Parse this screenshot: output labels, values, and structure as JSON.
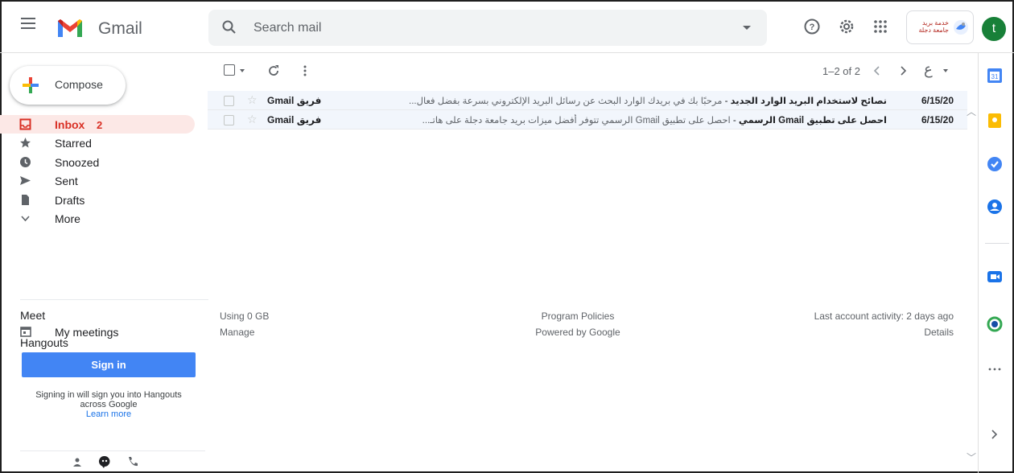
{
  "app": {
    "name": "Gmail"
  },
  "search": {
    "placeholder": "Search mail"
  },
  "org_badge": {
    "text": "خدمة بريد جامعة دجلة"
  },
  "account": {
    "initial": "t",
    "color": "#188038"
  },
  "compose": {
    "label": "Compose"
  },
  "nav": [
    {
      "label": "Inbox",
      "count": "2",
      "icon": "inbox-icon",
      "active": true
    },
    {
      "label": "Starred",
      "icon": "star-icon"
    },
    {
      "label": "Snoozed",
      "icon": "clock-icon"
    },
    {
      "label": "Sent",
      "icon": "send-icon"
    },
    {
      "label": "Drafts",
      "icon": "draft-icon"
    },
    {
      "label": "More",
      "icon": "chevron-down-icon"
    }
  ],
  "meet": {
    "title": "Meet",
    "my_meetings": "My meetings"
  },
  "hangouts": {
    "title": "Hangouts",
    "sign_in": "Sign in",
    "note": "Signing in will sign you into Hangouts across Google",
    "learn_more": "Learn more"
  },
  "toolbar": {
    "pager": "1–2 of 2",
    "lang": "ع"
  },
  "emails": [
    {
      "sender": "فريق Gmail",
      "subject": "نصائح لاستخدام البريد الوارد الجديد",
      "snippet": "مرحبًا بك في بريدك الوارد البحث عن رسائل البريد الإلكتروني بسرعة بفضل فعال...",
      "date": "6/15/20"
    },
    {
      "sender": "فريق Gmail",
      "subject": "احصل على تطبيق Gmail الرسمي",
      "snippet": "احصل على تطبيق Gmail الرسمي تتوفر أفضل ميزات بريد جامعة دجلة على هاتـ...",
      "date": "6/15/20"
    }
  ],
  "footer": {
    "storage": "Using 0 GB",
    "manage": "Manage",
    "policies": "Program Policies",
    "powered": "Powered by Google",
    "activity": "Last account activity: 2 days ago",
    "details": "Details"
  },
  "colors": {
    "accent_red": "#d93025",
    "blue": "#4285f4",
    "active_bg": "#fce8e6"
  }
}
